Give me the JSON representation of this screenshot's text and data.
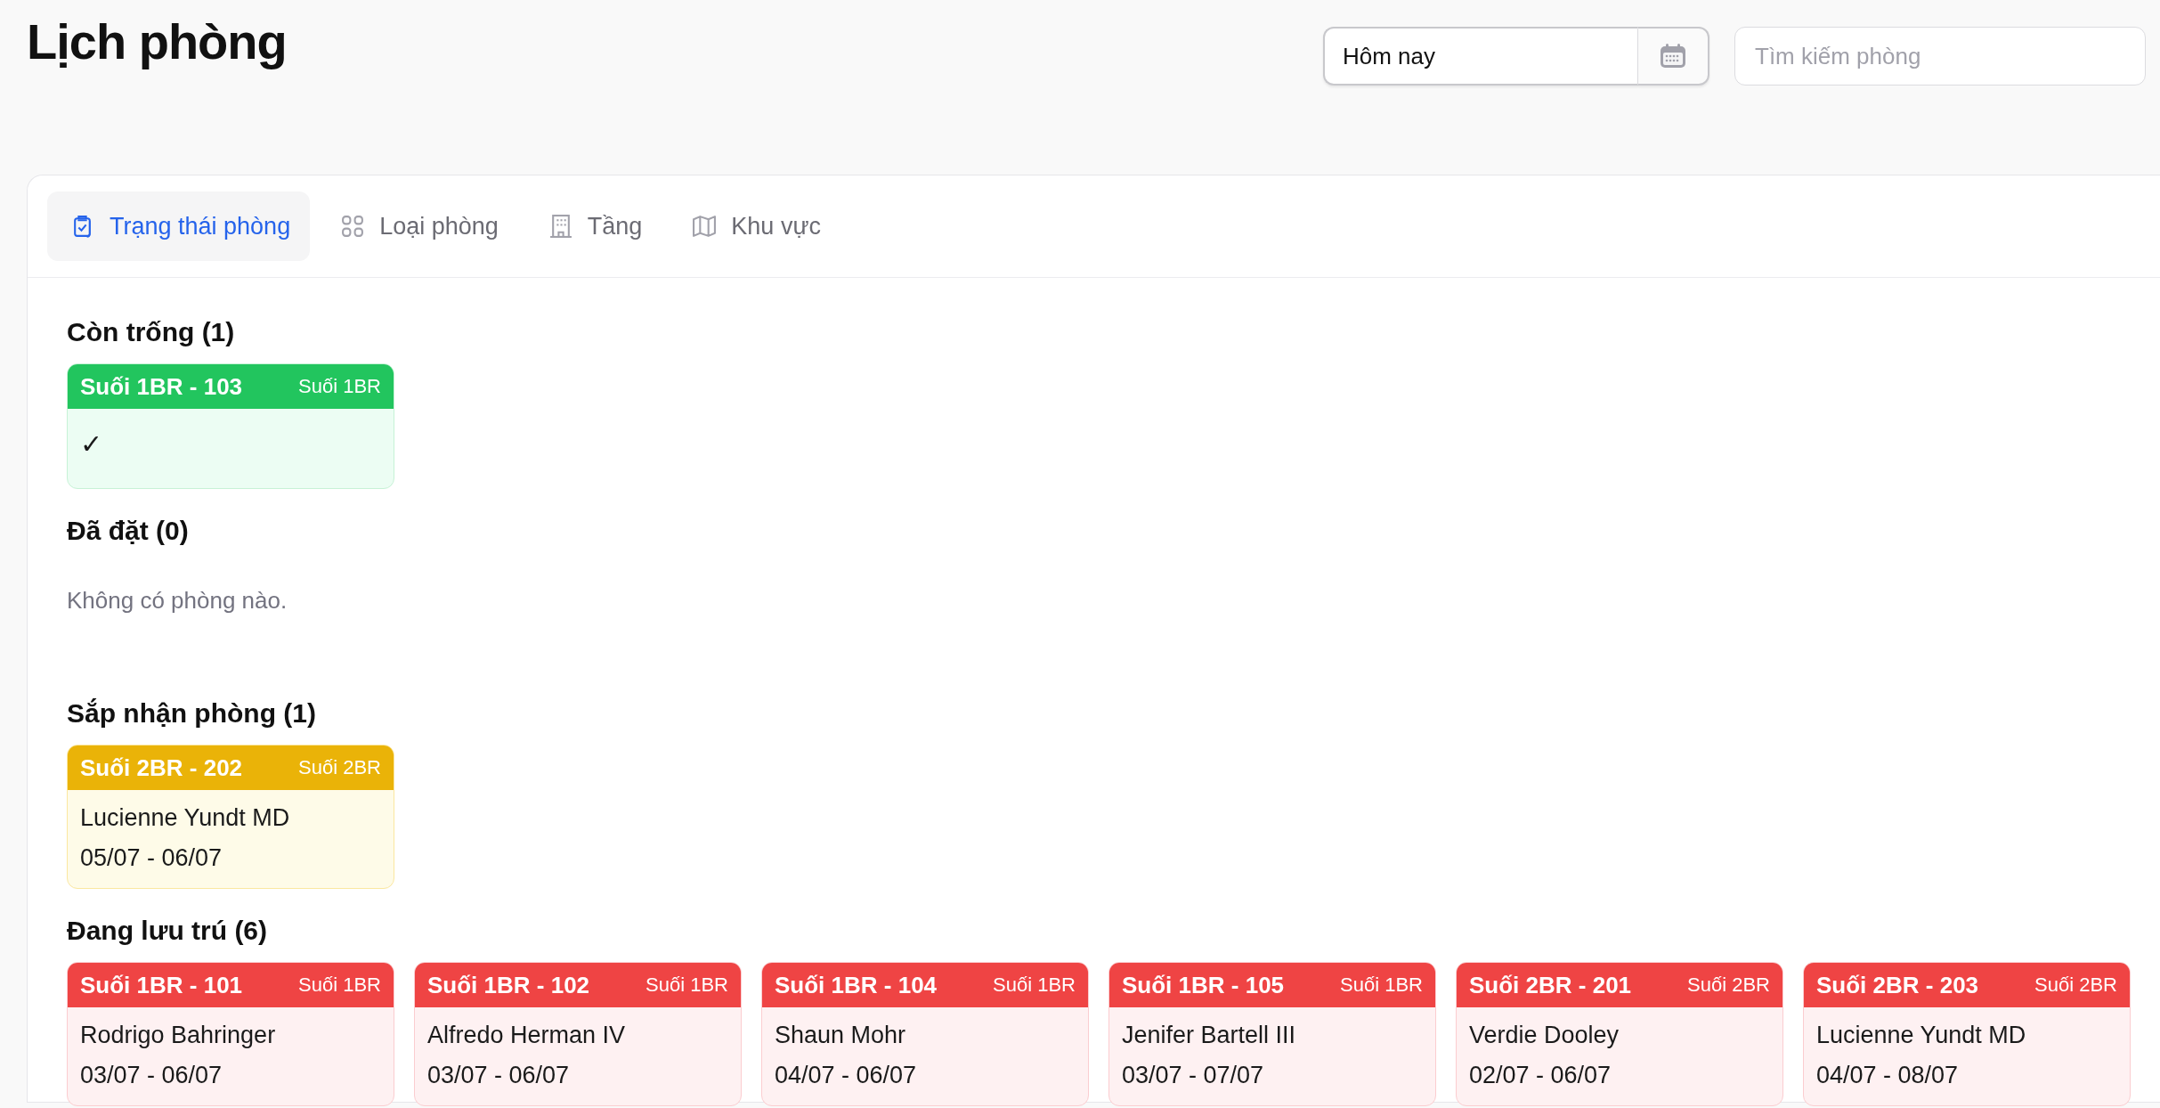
{
  "page": {
    "title": "Lịch phòng",
    "date_field": {
      "value": "Hôm nay"
    },
    "search": {
      "placeholder": "Tìm kiếm phòng"
    }
  },
  "tabs": [
    {
      "label": "Trạng thái phòng",
      "selected": true
    },
    {
      "label": "Loại phòng",
      "selected": false
    },
    {
      "label": "Tầng",
      "selected": false
    },
    {
      "label": "Khu vực",
      "selected": false
    }
  ],
  "sections": [
    {
      "title": "Còn trống (1)",
      "kind": "available",
      "rooms": [
        {
          "name": "Suối 1BR - 103",
          "type": "Suối 1BR",
          "mark": "✓"
        }
      ]
    },
    {
      "title": "Đã đặt (0)",
      "kind": "booked",
      "empty_text": "Không có phòng nào."
    },
    {
      "title": "Sắp nhận phòng (1)",
      "kind": "arriving",
      "rooms": [
        {
          "name": "Suối 2BR - 202",
          "type": "Suối 2BR",
          "guest": "Lucienne Yundt MD",
          "dates": "05/07 - 06/07"
        }
      ]
    },
    {
      "title": "Đang lưu trú (6)",
      "kind": "occupied",
      "rooms": [
        {
          "name": "Suối 1BR - 101",
          "type": "Suối 1BR",
          "guest": "Rodrigo Bahringer",
          "dates": "03/07 - 06/07"
        },
        {
          "name": "Suối 1BR - 102",
          "type": "Suối 1BR",
          "guest": "Alfredo Herman IV",
          "dates": "03/07 - 06/07"
        },
        {
          "name": "Suối 1BR - 104",
          "type": "Suối 1BR",
          "guest": "Shaun Mohr",
          "dates": "04/07 - 06/07"
        },
        {
          "name": "Suối 1BR - 105",
          "type": "Suối 1BR",
          "guest": "Jenifer Bartell III",
          "dates": "03/07 - 07/07"
        },
        {
          "name": "Suối 2BR - 201",
          "type": "Suối 2BR",
          "guest": "Verdie Dooley",
          "dates": "02/07 - 06/07"
        },
        {
          "name": "Suối 2BR - 203",
          "type": "Suối 2BR",
          "guest": "Lucienne Yundt MD",
          "dates": "04/07 - 08/07"
        }
      ]
    }
  ]
}
